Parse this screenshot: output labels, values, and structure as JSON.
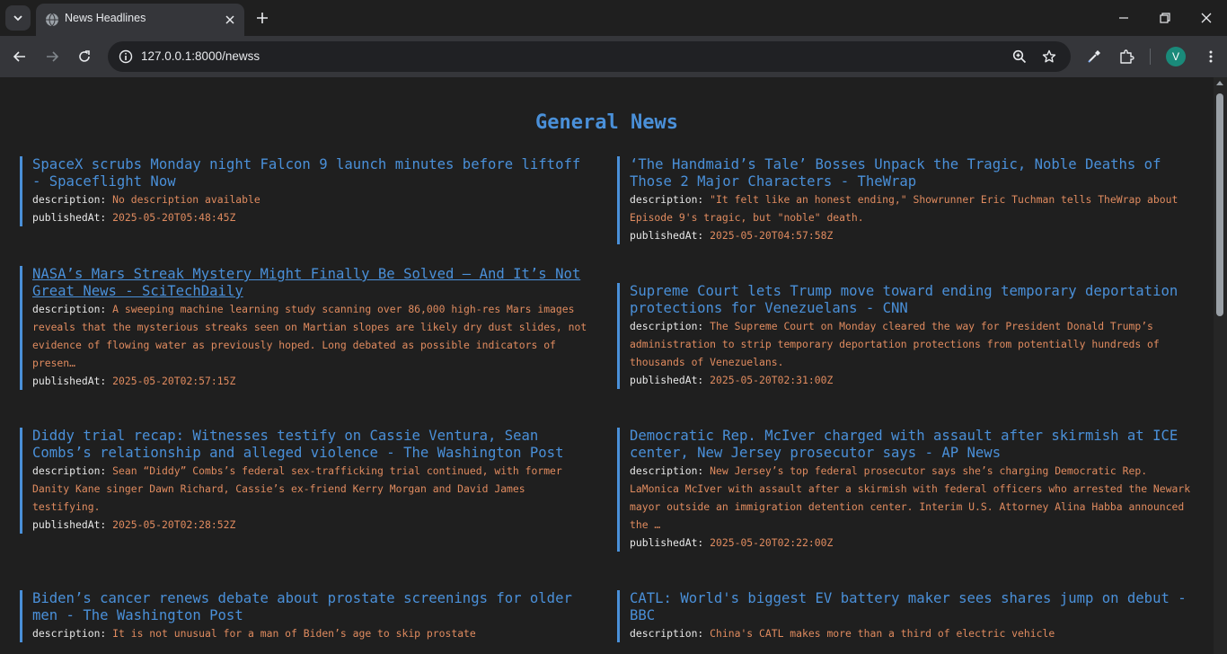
{
  "browser": {
    "tab_title": "News Headlines",
    "url": "127.0.0.1:8000/newss",
    "profile_initial": "V"
  },
  "page": {
    "title": "General News",
    "labels": {
      "description": "description:",
      "published": "publishedAt:"
    }
  },
  "articles": [
    {
      "title": "SpaceX scrubs Monday night Falcon 9 launch minutes before liftoff - Spaceflight Now",
      "description": "No description available",
      "publishedAt": "2025-05-20T05:48:45Z"
    },
    {
      "title": "‘The Handmaid’s Tale’ Bosses Unpack the Tragic, Noble Deaths of Those 2 Major Characters - TheWrap",
      "description": "\"It felt like an honest ending,\" Showrunner Eric Tuchman tells TheWrap about Episode 9's tragic, but \"noble\" death.",
      "publishedAt": "2025-05-20T04:57:58Z"
    },
    {
      "title": "NASA’s Mars Streak Mystery Might Finally Be Solved – And It’s Not Great News - SciTechDaily",
      "description": "A sweeping machine learning study scanning over 86,000 high-res Mars images reveals that the mysterious streaks seen on Martian slopes are likely dry dust slides, not evidence of flowing water as previously hoped. Long debated as possible indicators of presen…",
      "publishedAt": "2025-05-20T02:57:15Z"
    },
    {
      "title": "Supreme Court lets Trump move toward ending temporary deportation protections for Venezuelans - CNN",
      "description": "The Supreme Court on Monday cleared the way for President Donald Trump’s administration to strip temporary deportation protections from potentially hundreds of thousands of Venezuelans.",
      "publishedAt": "2025-05-20T02:31:00Z"
    },
    {
      "title": "Diddy trial recap: Witnesses testify on Cassie Ventura, Sean Combs’s relationship and alleged violence - The Washington Post",
      "description": "Sean “Diddy” Combs’s federal sex-trafficking trial continued, with former Danity Kane singer Dawn Richard, Cassie’s ex-friend Kerry Morgan and David James testifying.",
      "publishedAt": "2025-05-20T02:28:52Z"
    },
    {
      "title": "Democratic Rep. McIver charged with assault after skirmish at ICE center, New Jersey prosecutor says - AP News",
      "description": "New Jersey’s top federal prosecutor says she’s charging Democratic Rep. LaMonica McIver with assault after a skirmish with federal officers who arrested the Newark mayor outside an immigration detention center. Interim U.S. Attorney Alina Habba announced the …",
      "publishedAt": "2025-05-20T02:22:00Z"
    },
    {
      "title": "Biden’s cancer renews debate about prostate screenings for older men - The Washington Post",
      "description": "It is not unusual for a man of Biden’s age to skip prostate",
      "publishedAt": ""
    },
    {
      "title": "CATL: World's biggest EV battery maker sees shares jump on debut - BBC",
      "description": "China's CATL makes more than a third of electric vehicle",
      "publishedAt": ""
    }
  ]
}
